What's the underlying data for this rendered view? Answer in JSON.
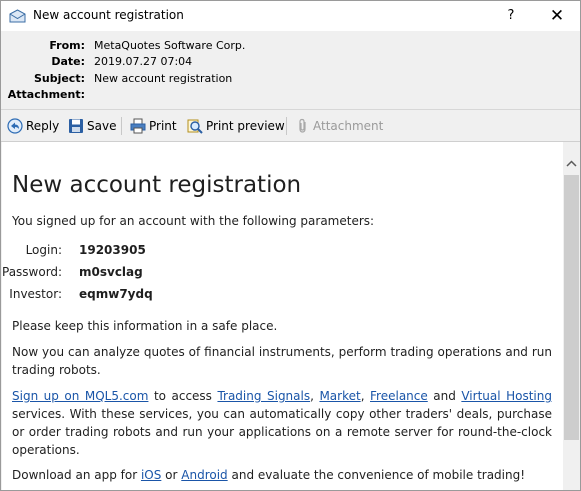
{
  "window": {
    "title": "New account registration",
    "help_label": "?",
    "close_label": "✕"
  },
  "header": {
    "from_label": "From:",
    "from_value": "MetaQuotes Software Corp.",
    "date_label": "Date:",
    "date_value": "2019.07.27 07:04",
    "subject_label": "Subject:",
    "subject_value": "New account registration",
    "attachment_label": "Attachment:",
    "attachment_value": ""
  },
  "toolbar": {
    "reply_label": "Reply",
    "save_label": "Save",
    "print_label": "Print",
    "print_preview_label": "Print preview",
    "attachment_label": "Attachment"
  },
  "message": {
    "heading": "New account registration",
    "intro": "You signed up for an account with the following parameters:",
    "login_label": "Login:",
    "login_value": "19203905",
    "password_label": "Password:",
    "password_value": "m0svclag",
    "investor_label": "Investor:",
    "investor_value": "eqmw7ydq",
    "keep_safe": "Please keep this information in a safe place.",
    "analyze": "Now you can analyze quotes of financial instruments, perform trading operations and run trading robots.",
    "signup_link": "Sign up on MQL5.com",
    "to_access": " to access ",
    "trading_signals_link": "Trading Signals",
    "comma1": ", ",
    "market_link": "Market",
    "comma2": ", ",
    "freelance_link": "Freelance",
    "and_text": " and ",
    "virtual_hosting_link": "Virtual Hosting",
    "services_text": " services. With these services, you can automatically copy other traders' deals, purchase or order trading robots and run your applications on a remote server for round-the-clock operations.",
    "download_prefix": "Download an app for ",
    "ios_link": "iOS",
    "or_text": " or ",
    "android_link": "Android",
    "download_suffix": " and evaluate the convenience of mobile trading!"
  },
  "colors": {
    "link": "#1a55a8",
    "window_bg": "#f0f0f0"
  }
}
